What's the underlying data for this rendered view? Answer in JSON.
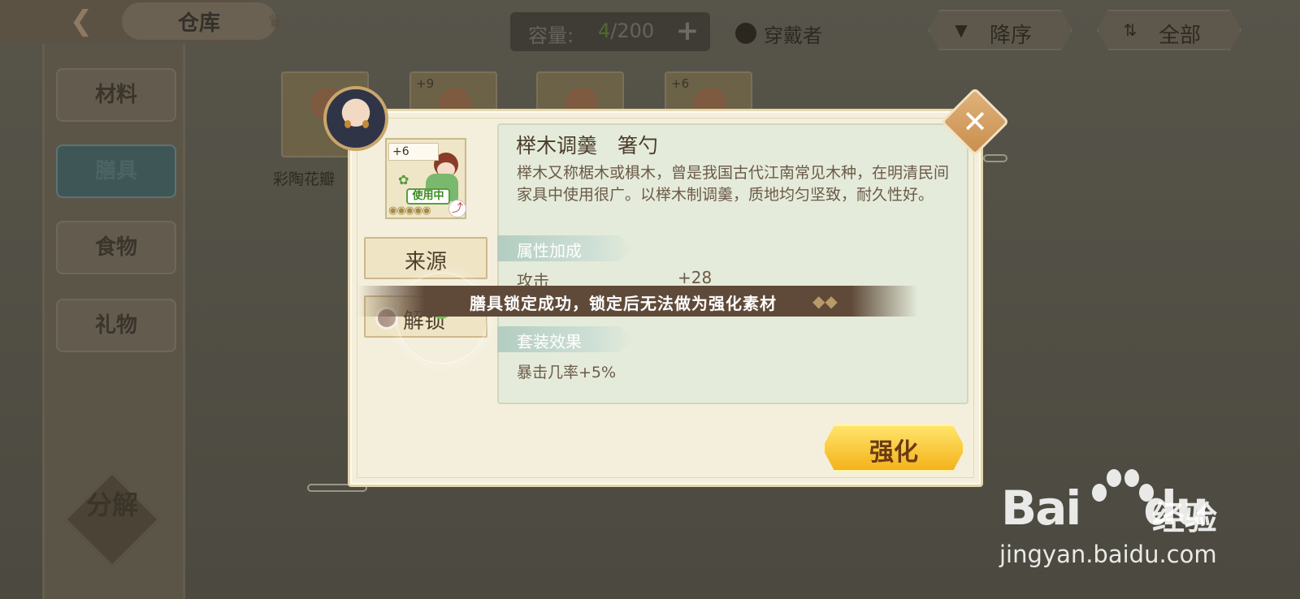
{
  "header": {
    "back_icon": "back-arrow-icon",
    "title": "仓库",
    "capacity_label": "容量:",
    "capacity_current": "4",
    "capacity_max": "/200",
    "capacity_add": "+",
    "wearer_label": "穿戴者",
    "sort_label": "降序",
    "filter_label": "全部"
  },
  "sidebar": {
    "tabs": [
      {
        "label": "材料"
      },
      {
        "label": "膳具",
        "active": true
      },
      {
        "label": "食物"
      },
      {
        "label": "礼物"
      }
    ],
    "decompose_label": "分解"
  },
  "background_items": [
    {
      "level": ""
    },
    {
      "level": "+9"
    },
    {
      "level": ""
    },
    {
      "level": "+6"
    }
  ],
  "background_item_name": "彩陶花瓣",
  "modal": {
    "item_level": "+6",
    "in_use": "使用中",
    "item_name": "榉木调羹　箸勺",
    "description": "榉木又称椐木或椇木，曾是我国古代江南常见木种，在明清民间家具中使用很广。以榉木制调羹，质地均匀坚致，耐久性好。",
    "attr_section_title": "属性加成",
    "attributes": [
      {
        "name": "攻击",
        "value": "+28"
      }
    ],
    "set_section_title": "套装效果",
    "set_effect": "暴击几率+5%",
    "source_button": "来源",
    "unlock_button": "解锁",
    "enhance_button": "强化",
    "close_icon": "close-icon"
  },
  "toast": {
    "text": "膳具锁定成功，锁定后无法做为强化素材"
  },
  "watermark": {
    "logo": "Bai",
    "logo_du": "du",
    "sub": "经验",
    "url": "jingyan.baidu.com"
  },
  "colors": {
    "overlay_bg": "#4f4d42",
    "modal_bg": "#f4efdc",
    "desc_panel_bg": "#e5ebda",
    "enhance_gold": "#f4b21c",
    "toast_bg": "#5f4a39",
    "in_use_green": "#3d8a1f"
  }
}
